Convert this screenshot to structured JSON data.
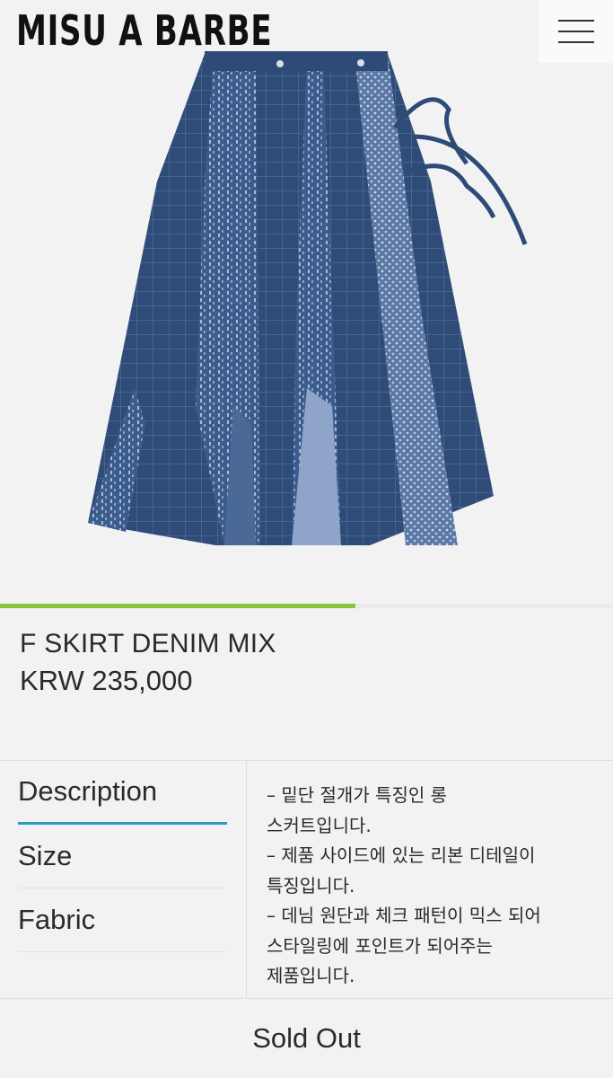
{
  "header": {
    "logo": "MISU A BARBE",
    "menu_icon": "hamburger-menu-icon"
  },
  "gallery": {
    "image_description": "skirt-photo",
    "progress_fraction": 0.58,
    "progress_color": "#8ac43f"
  },
  "product": {
    "name": "F SKIRT DENIM MIX",
    "price": "KRW 235,000"
  },
  "info": {
    "tabs": [
      {
        "label": "Description",
        "active": true
      },
      {
        "label": "Size",
        "active": false
      },
      {
        "label": "Fabric",
        "active": false
      }
    ],
    "active_tab_color": "#2a9ac2",
    "description_lines": [
      "– 밑단 절개가 특징인 롱",
      "스커트입니다.",
      "– 제품 사이드에 있는 리본 디테일이",
      "특징입니다.",
      "– 데님 원단과 체크 패턴이 믹스 되어",
      "스타일링에 포인트가 되어주는",
      "제품입니다."
    ]
  },
  "actions": {
    "sold_out_label": "Sold Out"
  }
}
